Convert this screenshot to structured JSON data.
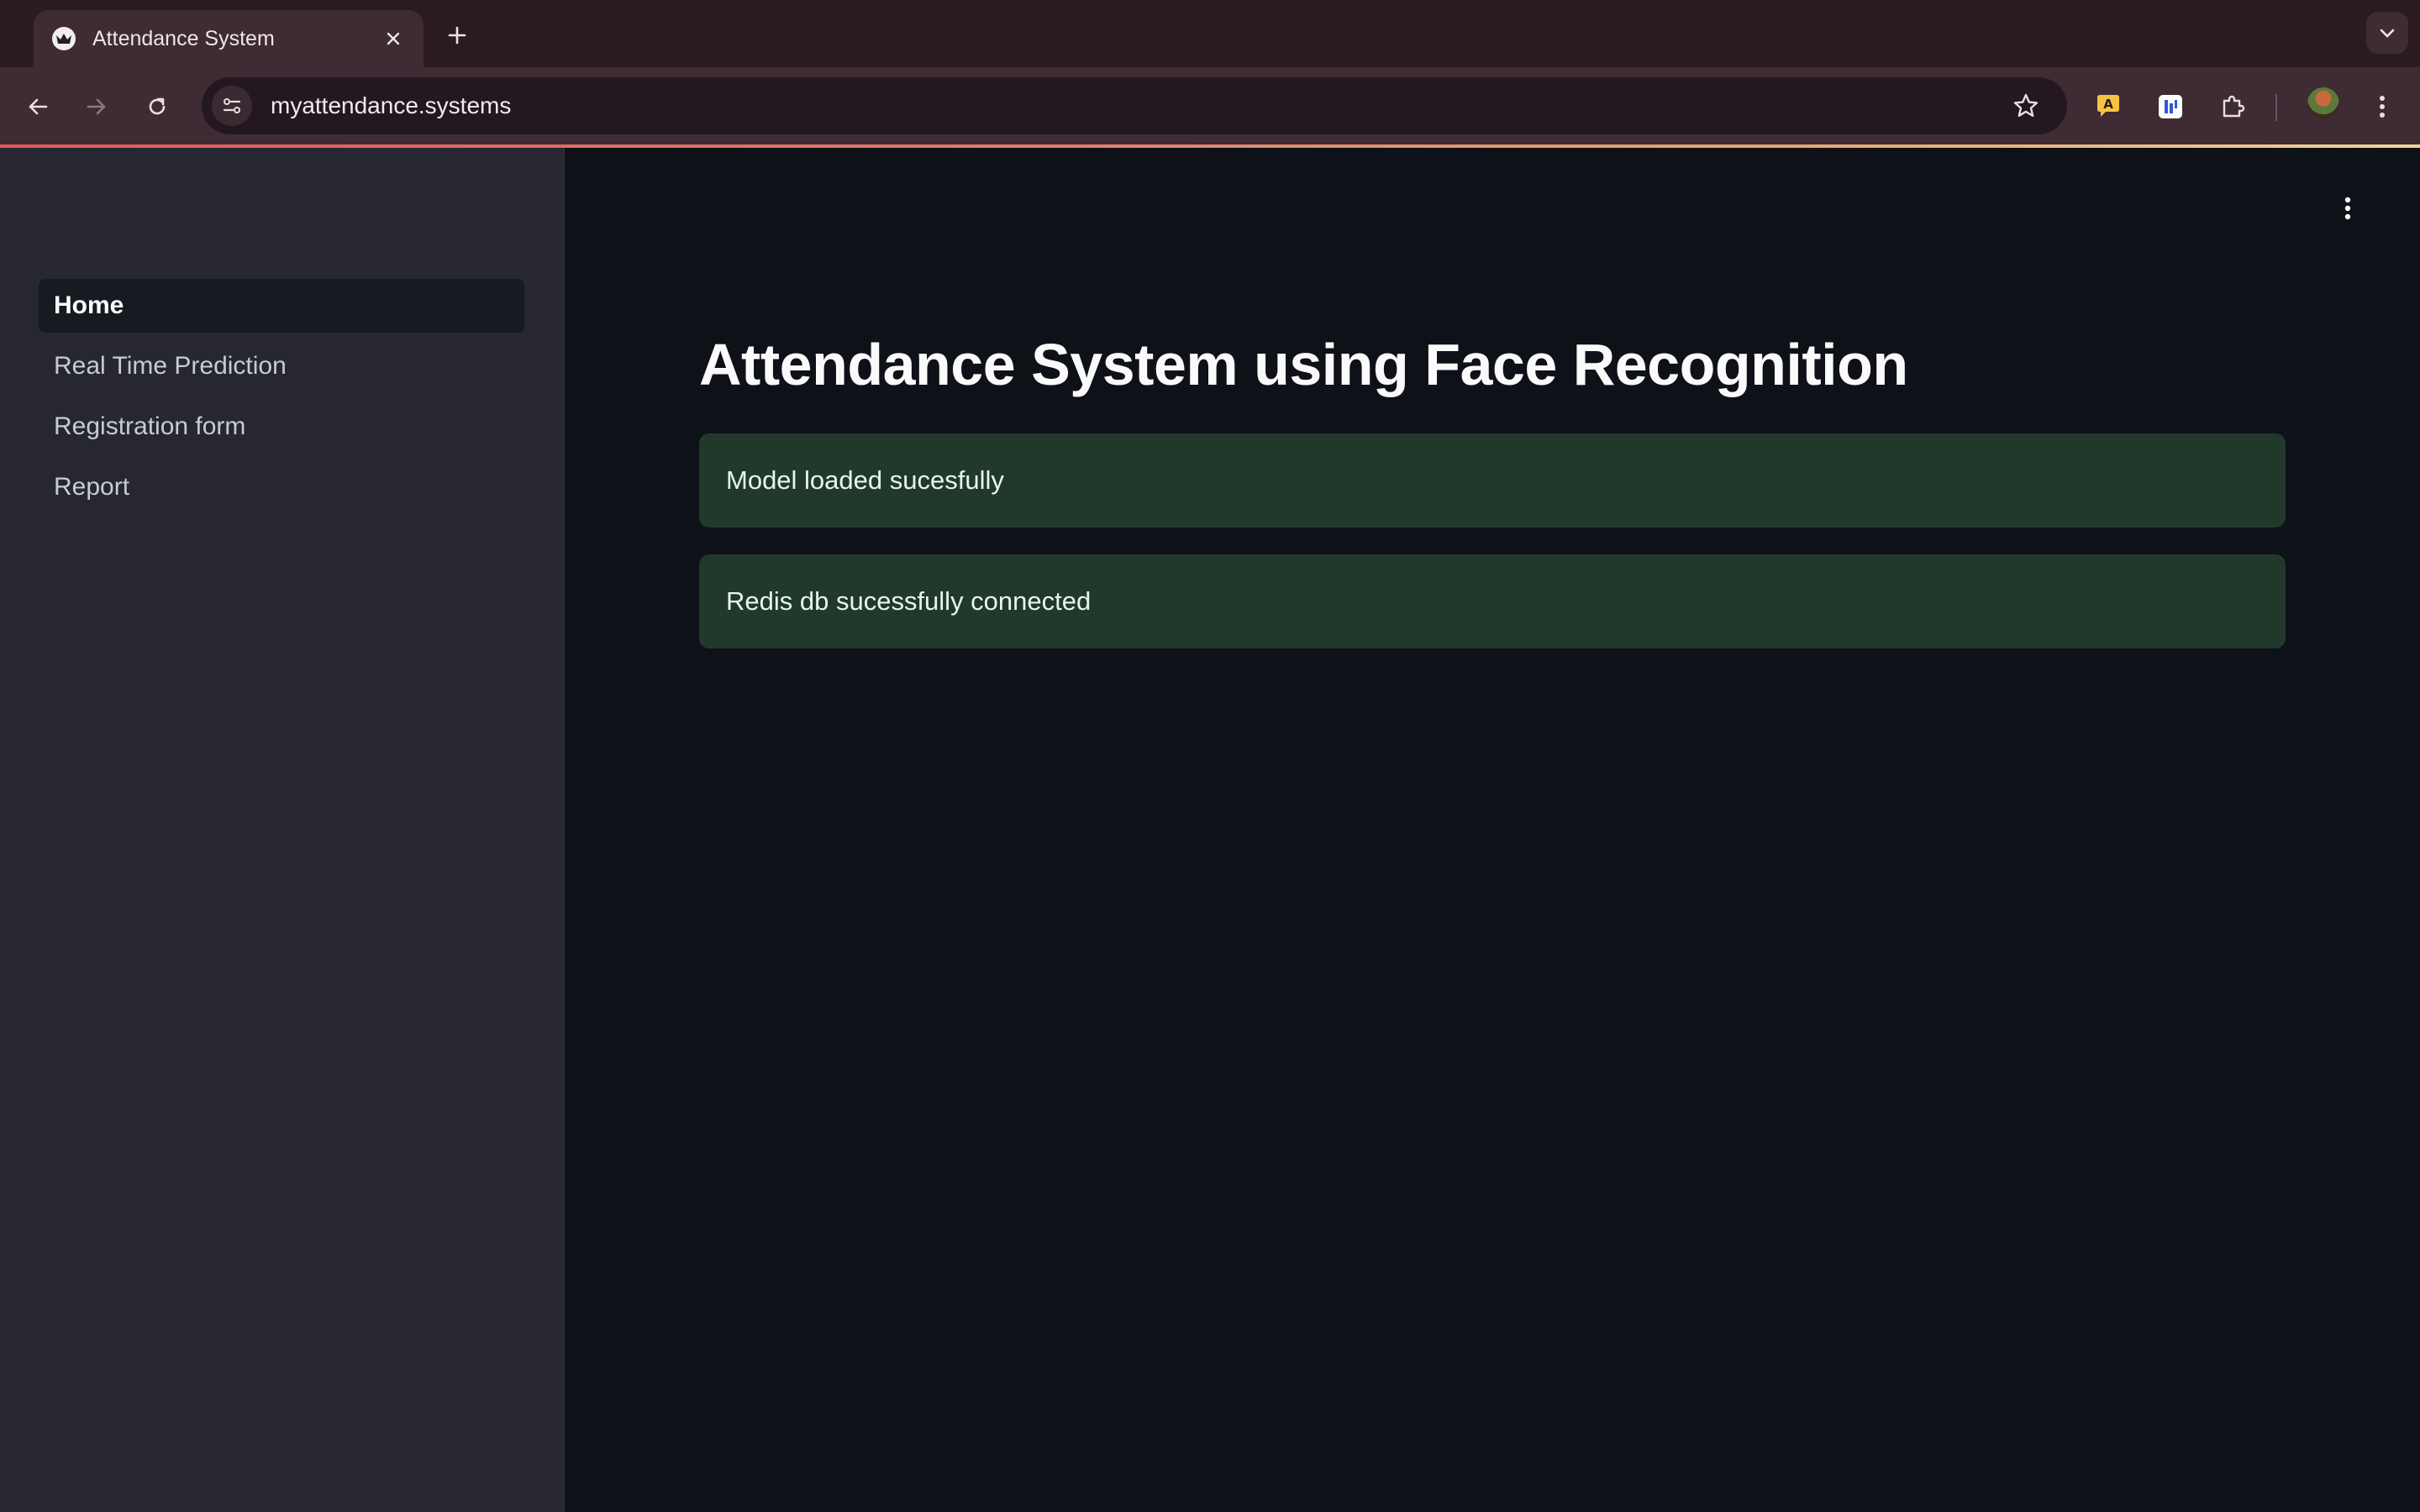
{
  "browser": {
    "tab_title": "Attendance System",
    "url": "myattendance.systems"
  },
  "sidebar": {
    "items": [
      {
        "label": "Home",
        "active": true
      },
      {
        "label": "Real Time Prediction",
        "active": false
      },
      {
        "label": "Registration form",
        "active": false
      },
      {
        "label": "Report",
        "active": false
      }
    ]
  },
  "main": {
    "title": "Attendance System using Face Recognition",
    "alerts": [
      {
        "text": "Model loaded sucesfully",
        "type": "success"
      },
      {
        "text": "Redis db sucessfully connected",
        "type": "success"
      }
    ]
  },
  "colors": {
    "sidebar_bg": "#262730",
    "main_bg": "#0e1117",
    "success_bg": "#20392b",
    "chrome_bg": "#3f2b33"
  },
  "icons": [
    "streamlit-crown-icon",
    "close-icon",
    "plus-icon",
    "chevron-down-icon",
    "back-arrow-icon",
    "forward-arrow-icon",
    "reload-icon",
    "site-settings-icon",
    "star-icon",
    "extension-a-icon",
    "extension-bar-icon",
    "puzzle-icon",
    "profile-avatar",
    "more-vert-icon"
  ]
}
